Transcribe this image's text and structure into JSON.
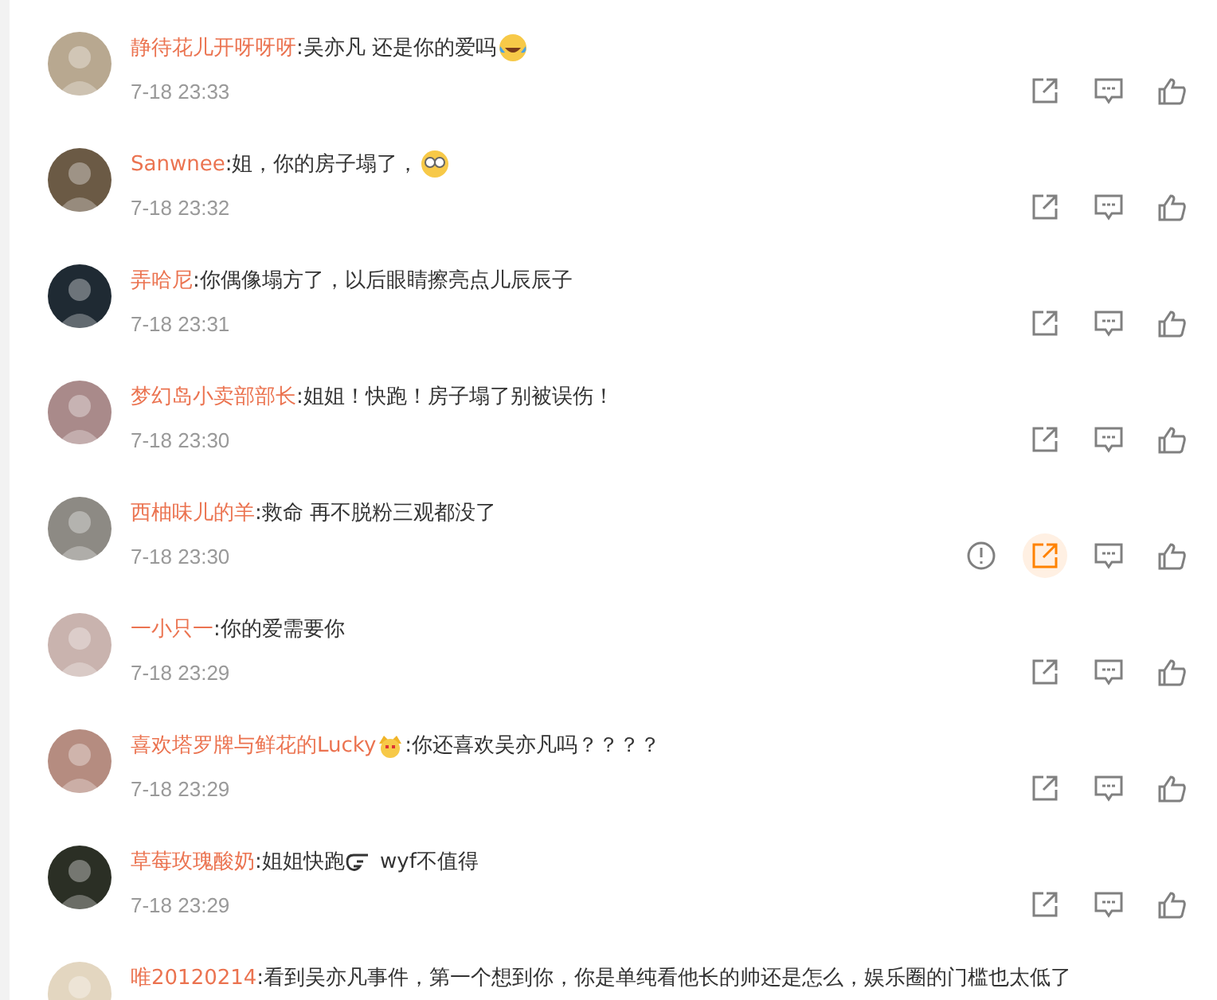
{
  "comments": [
    {
      "name": "静待花儿开呀呀呀",
      "parts": [
        {
          "kind": "text",
          "text": ":吴亦凡 还是你的爱吗"
        },
        {
          "kind": "tears"
        }
      ],
      "time": "7-18 23:33",
      "hovered": false
    },
    {
      "name": "Sanwnee",
      "parts": [
        {
          "kind": "text",
          "text": ":姐，你的房子塌了，"
        },
        {
          "kind": "glasses"
        }
      ],
      "time": "7-18 23:32",
      "hovered": false
    },
    {
      "name": "弄哈尼",
      "parts": [
        {
          "kind": "text",
          "text": ":你偶像塌方了，以后眼睛擦亮点儿辰辰子"
        }
      ],
      "time": "7-18 23:31",
      "hovered": false
    },
    {
      "name": "梦幻岛小卖部部长",
      "parts": [
        {
          "kind": "text",
          "text": ":姐姐！快跑！房子塌了别被误伤！"
        }
      ],
      "time": "7-18 23:30",
      "hovered": false
    },
    {
      "name": "西柚味儿的羊",
      "parts": [
        {
          "kind": "text",
          "text": ":救命 再不脱粉三观都没了"
        }
      ],
      "time": "7-18 23:30",
      "hovered": true
    },
    {
      "name": "一小只一",
      "parts": [
        {
          "kind": "text",
          "text": ":你的爱需要你"
        }
      ],
      "time": "7-18 23:29",
      "hovered": false
    },
    {
      "name": "喜欢塔罗牌与鲜花的Lucky",
      "parts": [
        {
          "kind": "crown"
        },
        {
          "kind": "text",
          "text": ":你还喜欢吴亦凡吗？？？？"
        }
      ],
      "time": "7-18 23:29",
      "hovered": false
    },
    {
      "name": "草莓玫瑰酸奶",
      "parts": [
        {
          "kind": "text",
          "text": ":姐姐快跑"
        },
        {
          "kind": "hand"
        },
        {
          "kind": "text",
          "text": " wyf不值得"
        }
      ],
      "time": "7-18 23:29",
      "hovered": false
    },
    {
      "name": "唯20120214",
      "parts": [
        {
          "kind": "text",
          "text": ":看到吴亦凡事件，第一个想到你，你是单纯看他长的帅还是怎么，娱乐圈的门槛也太低了"
        }
      ]
    }
  ]
}
